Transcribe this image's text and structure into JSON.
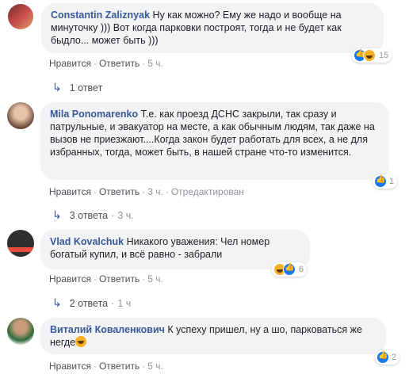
{
  "comments": [
    {
      "author": "Constantin Zaliznyak",
      "text": "Ну как можно? Ему же надо и вообще на минуточку ))) Вот когда парковки построят, тогда и не будет как быдло... может быть )))",
      "like": "Нравится",
      "reply": "Ответить",
      "time": "5 ч.",
      "reactions_count": "15",
      "replies_text": "1 ответ"
    },
    {
      "author": "Mila Ponomarenko",
      "text": "Т.е. как проезд ДСНС закрыли, так сразу и патрульные, и эвакуатор на месте, а как обычным людям, так даже на вызов не приезжают....Когда закон будет работать для всех, а не для избранных, тогда, может быть, в нашей стране что-то изменится.",
      "like": "Нравится",
      "reply": "Ответить",
      "time": "3 ч.",
      "edited": "Отредактирован",
      "reactions_count": "1",
      "replies_text": "3 ответа",
      "replies_time": "3 ч."
    },
    {
      "author": "Vlad Kovalchuk",
      "text": "Никакого уважения: Чел номер богатый купил, и всё равно - забрали",
      "like": "Нравится",
      "reply": "Ответить",
      "time": "5 ч.",
      "reactions_count": "6",
      "replies_text": "2 ответа",
      "replies_time": "1 ч"
    },
    {
      "author": "Виталий Коваленкович",
      "text": "К успеху пришел, ну а шо, парковаться же негде",
      "like": "Нравится",
      "reply": "Ответить",
      "time": "5 ч.",
      "reactions_count": "2"
    }
  ],
  "colors": {
    "author": "#385898",
    "bubble": "#f2f3f5",
    "like_blue": "#1877f2",
    "haha_yellow": "#f7b125"
  },
  "icons": [
    "like-reaction-icon",
    "haha-reaction-icon",
    "reply-arrow-icon"
  ]
}
